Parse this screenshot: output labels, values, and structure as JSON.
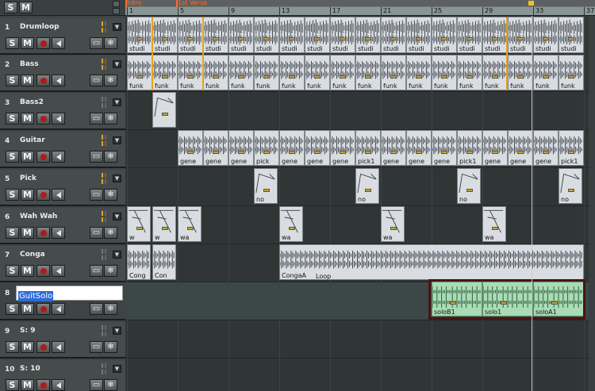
{
  "header": {
    "solo_label": "S",
    "mute_label": "M"
  },
  "tracks": [
    {
      "num": "1",
      "name": "Drumloop"
    },
    {
      "num": "2",
      "name": "Bass"
    },
    {
      "num": "3",
      "name": "Bass2"
    },
    {
      "num": "4",
      "name": "Guitar"
    },
    {
      "num": "5",
      "name": "Pick"
    },
    {
      "num": "6",
      "name": "Wah Wah"
    },
    {
      "num": "7",
      "name": "Conga"
    },
    {
      "num": "8",
      "name": "GuitSolo"
    },
    {
      "num": "9",
      "name": "S: 9"
    },
    {
      "num": "10",
      "name": "S: 10"
    }
  ],
  "buttons": {
    "solo": "S",
    "mute": "M",
    "archive_icon": "archive-icon",
    "freeze_icon": "freeze-icon"
  },
  "markers": [
    {
      "label": "Intro"
    },
    {
      "label": "1st Verse"
    }
  ],
  "ruler": [
    "1",
    "5",
    "9",
    "13",
    "17",
    "21",
    "25",
    "29",
    "33",
    "37"
  ],
  "clips": {
    "drum": "studi",
    "bass": "funk",
    "guitar": [
      "gene",
      "gene",
      "gene",
      "pick",
      "gene",
      "gene",
      "gene",
      "pick1",
      "gene",
      "gene",
      "gene",
      "pick1",
      "gene",
      "gene",
      "gene",
      "pick1"
    ],
    "pick": "no",
    "wah": [
      "w",
      "w",
      "wa",
      "wa",
      "wa",
      "wa",
      "wa"
    ],
    "conga": [
      "Cong",
      "Con",
      "CongaA",
      "Loop"
    ],
    "solo": [
      "soloB1",
      "solo1",
      "soloA1"
    ]
  }
}
